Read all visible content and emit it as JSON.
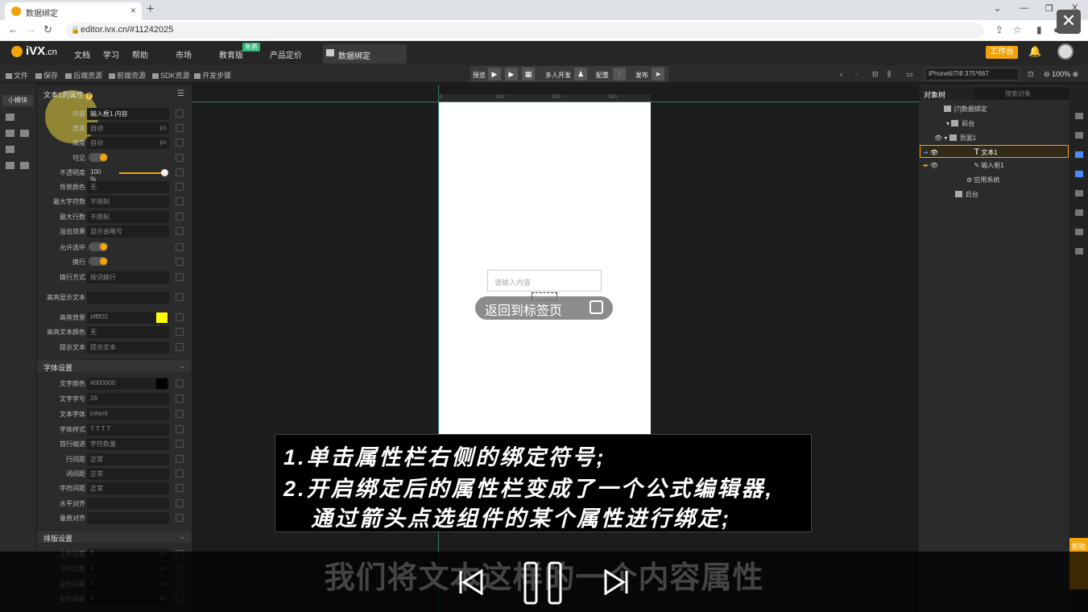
{
  "browser": {
    "tab_title": "数据绑定",
    "tab_close": "×",
    "new_tab": "+",
    "url": "editor.ivx.cn/#11242025",
    "win_min": "—",
    "win_restore": "❐",
    "win_close": "X",
    "win_chevron": "⌄",
    "overlay_close": "✕"
  },
  "app": {
    "logo": "iVX",
    "logo_suffix": ".cn",
    "menu": [
      "文档",
      "学习",
      "帮助",
      "市场",
      "教育版",
      "产品定价"
    ],
    "free_badge": "免费",
    "current_tab": "数据绑定",
    "work_button": "工作台"
  },
  "toolbar": {
    "items": [
      "文件",
      "保存",
      "后端资源",
      "前端资源",
      "SDK资源",
      "开发步骤"
    ],
    "preview": "预览",
    "multi_dev": "多人开发",
    "config": "配置",
    "publish": "发布",
    "device": "iPhone6/7/8 375*667",
    "zoom": "100%"
  },
  "rail": {
    "tab": "小模块"
  },
  "props": {
    "title": "文本1的属性",
    "rows": [
      {
        "label": "内容",
        "value": "输入框1.内容"
      },
      {
        "label": "宽度",
        "value": "自动",
        "unit": "px"
      },
      {
        "label": "高度",
        "value": "自动",
        "unit": "px"
      },
      {
        "label": "可见"
      },
      {
        "label": "不透明度",
        "value": "100 %"
      },
      {
        "label": "背景颜色",
        "value": "无"
      },
      {
        "label": "最大字符数",
        "value": "不限制"
      },
      {
        "label": "最大行数",
        "value": "不限制"
      },
      {
        "label": "溢出效果",
        "value": "显示省略号"
      },
      {
        "label": "允许选中"
      },
      {
        "label": "换行"
      },
      {
        "label": "换行方式",
        "value": "按词换行"
      },
      {
        "label": "高亮显示文本",
        "value": ""
      },
      {
        "label": "高亮背景",
        "value": "#ffff00"
      },
      {
        "label": "高亮文本颜色",
        "value": "无"
      },
      {
        "label": "提示文本",
        "value": "提示文本"
      }
    ],
    "font_section": "字体设置",
    "font_rows": [
      {
        "label": "文字颜色",
        "value": "#000000"
      },
      {
        "label": "文字字号",
        "value": "26"
      },
      {
        "label": "文本字体",
        "value": "inherit"
      },
      {
        "label": "字体样式",
        "value": "T  T  T  T"
      },
      {
        "label": "首行缩进",
        "value": "字符数量"
      },
      {
        "label": "行间距",
        "value": "正常"
      },
      {
        "label": "词间距",
        "value": "正常"
      },
      {
        "label": "字符间距",
        "value": "正常"
      },
      {
        "label": "水平对齐",
        "value": ""
      },
      {
        "label": "垂直对齐",
        "value": ""
      }
    ],
    "layout_section": "排版设置",
    "layout_rows": [
      {
        "label": "上外边距",
        "value": "0",
        "unit": "px"
      },
      {
        "label": "下外边距",
        "value": "0",
        "unit": "px"
      },
      {
        "label": "左外边距",
        "value": "0",
        "unit": "px"
      },
      {
        "label": "右外边距",
        "value": "0",
        "unit": "px"
      }
    ]
  },
  "canvas": {
    "ruler": [
      "0",
      "100",
      "200",
      "300"
    ],
    "input_placeholder": "请输入内容",
    "back_button": "返回到标签页"
  },
  "objects": {
    "tab": "对象树",
    "search": "搜索对象",
    "tree": [
      "[7]数据绑定",
      "前台",
      "页面1",
      "文本1",
      "输入框1",
      "应用系统",
      "后台"
    ]
  },
  "help": "帮助",
  "caption": {
    "line1": "1.单击属性栏右侧的绑定符号;",
    "line2": "2.开启绑定后的属性栏变成了一个公式编辑器,",
    "line3": "通过箭头点选组件的某个属性进行绑定;"
  },
  "subtitle": "我们将文本这样的一个内容属性",
  "colors": {
    "accent": "#f0a30a",
    "highlight": "#ffff00",
    "guide": "#2e7d6e"
  }
}
